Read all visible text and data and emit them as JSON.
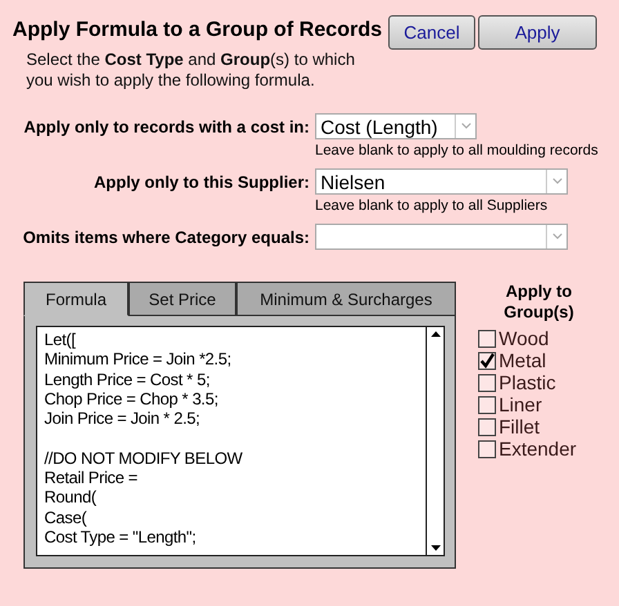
{
  "title": "Apply Formula to a Group of Records",
  "description": "Select the **Cost Type** and **Group**(s) to which you wish to apply the following formula.",
  "buttons": [
    "Cancel",
    "Apply"
  ],
  "filters": [
    {
      "label": "Apply only to records with a cost in:",
      "value": "Cost (Length)",
      "hint": "Leave blank to apply to all moulding records"
    },
    {
      "label": "Apply only to this Supplier:",
      "value": "Nielsen",
      "hint": "Leave blank to apply to all Suppliers"
    },
    {
      "label": "Omits items where Category equals:"
    }
  ],
  "tabs": [
    {
      "label": "Formula",
      "selected": true
    },
    {
      "label": "Set Price",
      "selected": false
    },
    {
      "label": "Minimum & Surcharges",
      "selected": false
    }
  ],
  "formula": "Let([\nMinimum Price = Join *2.5;\nLength Price = Cost * 5;\nChop Price = Chop * 3.5;\nJoin Price = Join * 2.5;\n\n//DO NOT MODIFY BELOW\nRetail Price =\nRound(\nCase(\nCost Type = \"Length\";",
  "groups": {
    "heading": "Apply to Group(s)",
    "items": [
      {
        "label": "Wood",
        "checked": false
      },
      {
        "label": "Metal",
        "checked": true
      },
      {
        "label": "Plastic",
        "checked": false
      },
      {
        "label": "Liner",
        "checked": false
      },
      {
        "label": "Fillet",
        "checked": false
      },
      {
        "label": "Extender",
        "checked": false
      }
    ]
  }
}
